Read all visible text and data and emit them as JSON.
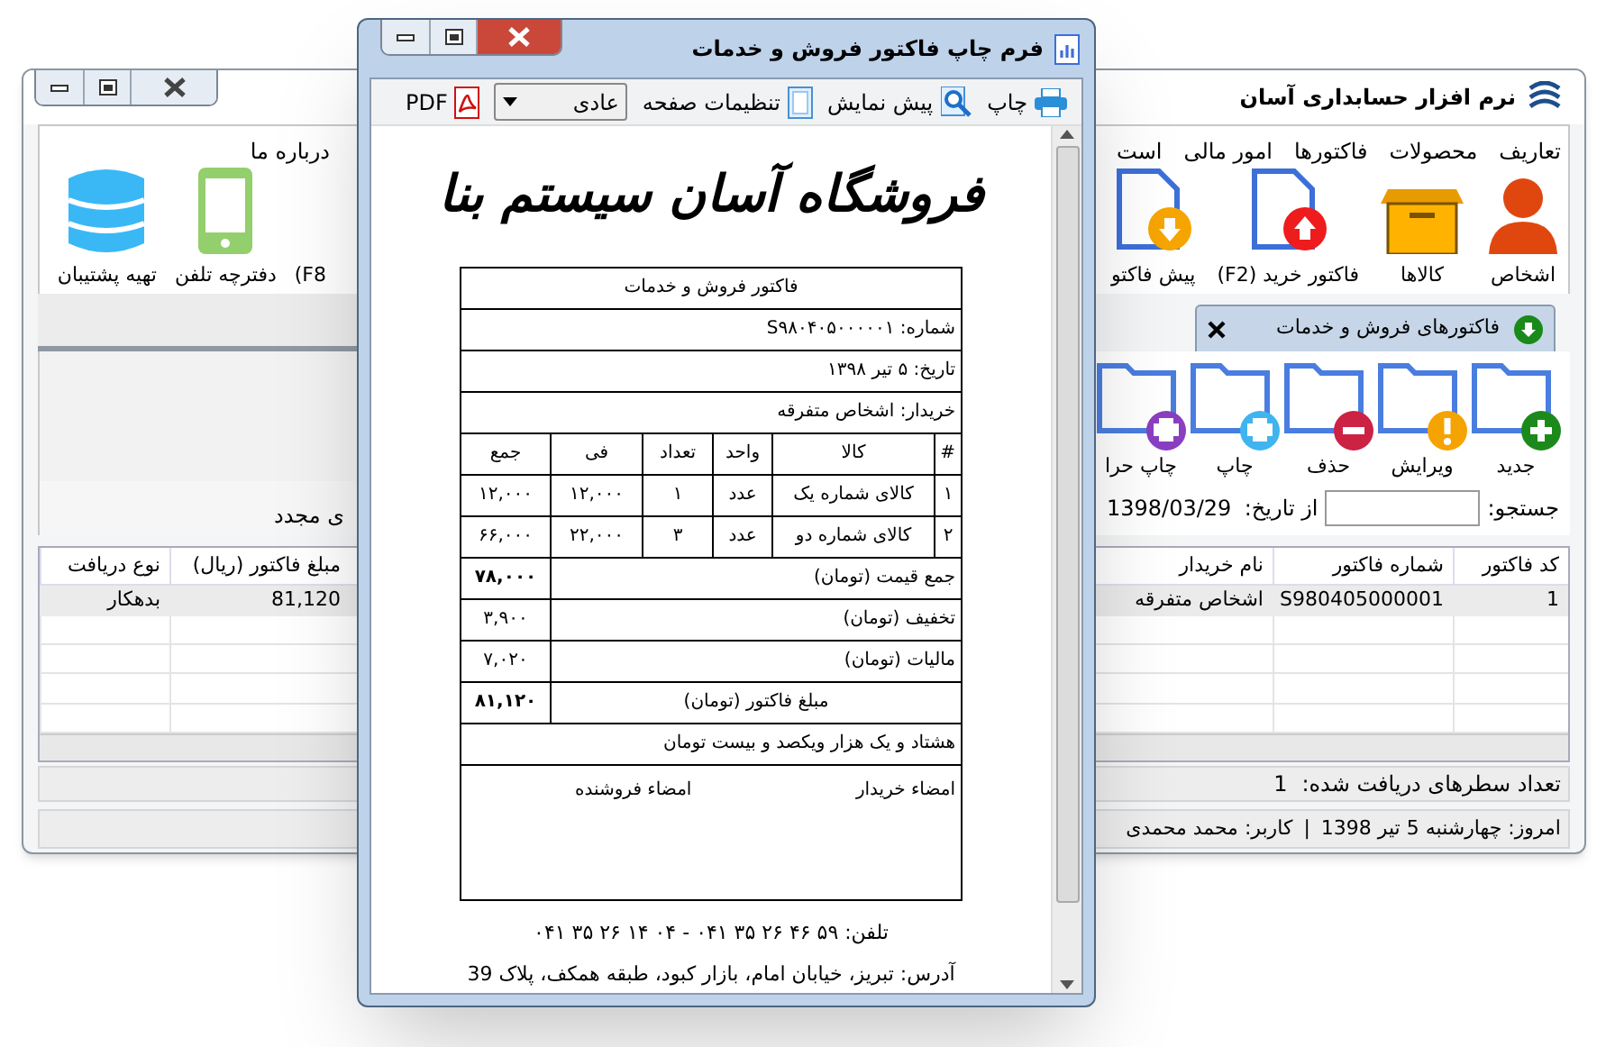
{
  "main_window": {
    "title": "نرم افزار حسابداری آسان",
    "menu": [
      "تعاریف",
      "محصولات",
      "فاکتورها",
      "امور مالی",
      "است"
    ],
    "menu_left": [
      "درباره ما"
    ],
    "toolbar": [
      {
        "label": "اشخاص",
        "kind": "person"
      },
      {
        "label": "کالاها",
        "kind": "box"
      },
      {
        "label": "فاکتور خرید (F2)",
        "kind": "doc-up"
      },
      {
        "label": "پیش فاکتو",
        "kind": "doc-down"
      }
    ],
    "toolbar_left": [
      {
        "label": "(F8",
        "kind": "text"
      },
      {
        "label": "دفترچه تلفن",
        "kind": "phone"
      },
      {
        "label": "تهیه پشتیبان",
        "kind": "database"
      }
    ],
    "tab": {
      "label": "فاکتورهای فروش و خدمات",
      "selected": true
    },
    "actions": [
      {
        "label": "جدید",
        "color": "#1b8a1b",
        "kind": "plus"
      },
      {
        "label": "ویرایش",
        "color": "#f5a300",
        "kind": "alert"
      },
      {
        "label": "حذف",
        "color": "#cc2244",
        "kind": "minus"
      },
      {
        "label": "چاپ",
        "color": "#3fb4ef",
        "kind": "print"
      },
      {
        "label": "چاپ حرا",
        "color": "#8a3fc0",
        "kind": "print"
      }
    ],
    "search": {
      "label": "جستجو:"
    },
    "date_from": {
      "label": "از تاریخ:",
      "value": "1398/03/29"
    },
    "left_caption": "ی مجدد",
    "grid": {
      "columns": [
        "کد فاکتور",
        "شماره فاکتور",
        "نام خریدار"
      ],
      "rows": [
        [
          "1",
          "S980405000001",
          "اشخاص متفرقه"
        ]
      ]
    },
    "grid_left": {
      "columns": [
        "مبلغ فاکتور (ریال)",
        "نوع دریافت"
      ],
      "rows": [
        [
          "81,120",
          "بدهکار"
        ]
      ]
    },
    "row_count": {
      "label": "تعداد سطرهای دریافت شده:",
      "value": "1"
    },
    "status": [
      "امروز: چهارشنبه 5 تیر 1398",
      "|",
      "کاربر: محمد محمدی"
    ]
  },
  "print_dialog": {
    "title": "فرم چاپ فاکتور فروش و خدمات",
    "toolbar": [
      {
        "kind": "print",
        "label": "چاپ"
      },
      {
        "kind": "preview",
        "label": "پیش نمایش"
      },
      {
        "kind": "page-setup",
        "label": "تنظیمات صفحه"
      },
      {
        "kind": "select",
        "label": "عادی"
      },
      {
        "kind": "pdf",
        "label": "PDF"
      }
    ],
    "invoice": {
      "shop_name": "فروشگاه آسان سیستم بنا",
      "title": "فاکتور فروش و خدمات",
      "number": "شماره: S۹۸۰۴۰۵۰۰۰۰۰۱",
      "date": "تاریخ: ۵ تیر ۱۳۹۸",
      "buyer": "خریدار: اشخاص متفرقه",
      "columns": [
        "#",
        "کالا",
        "واحد",
        "تعداد",
        "فی",
        "جمع"
      ],
      "items": [
        [
          "۱",
          "کالای شماره یک",
          "عدد",
          "۱",
          "۱۲,۰۰۰",
          "۱۲,۰۰۰"
        ],
        [
          "۲",
          "کالای شماره دو",
          "عدد",
          "۳",
          "۲۲,۰۰۰",
          "۶۶,۰۰۰"
        ]
      ],
      "totals": [
        {
          "kind": "subtotal",
          "label": "جمع قیمت (تومان)",
          "value": "۷۸,۰۰۰"
        },
        {
          "kind": "adjustment",
          "label": "تخفیف (تومان)",
          "value": "۳,۹۰۰"
        },
        {
          "kind": "adjustment",
          "label": "مالیات (تومان)",
          "value": "۷,۰۲۰"
        },
        {
          "kind": "grand",
          "label": "مبلغ فاکتور (تومان)",
          "value": "۸۱,۱۲۰"
        }
      ],
      "amount_in_words": "هشتاد و یک هزار ویکصد و بیست تومان",
      "signatures": [
        "امضاء خریدار",
        "امضاء فروشنده"
      ],
      "phone": "تلفن: ۵۹ ۴۶ ۲۶ ۳۵ ۰۴۱ - ۰۴ ۱۴ ۲۶ ۳۵ ۰۴۱",
      "address": "آدرس: تبریز، خیابان امام، بازار کبود، طبقه همکف، پلاک 39"
    }
  }
}
